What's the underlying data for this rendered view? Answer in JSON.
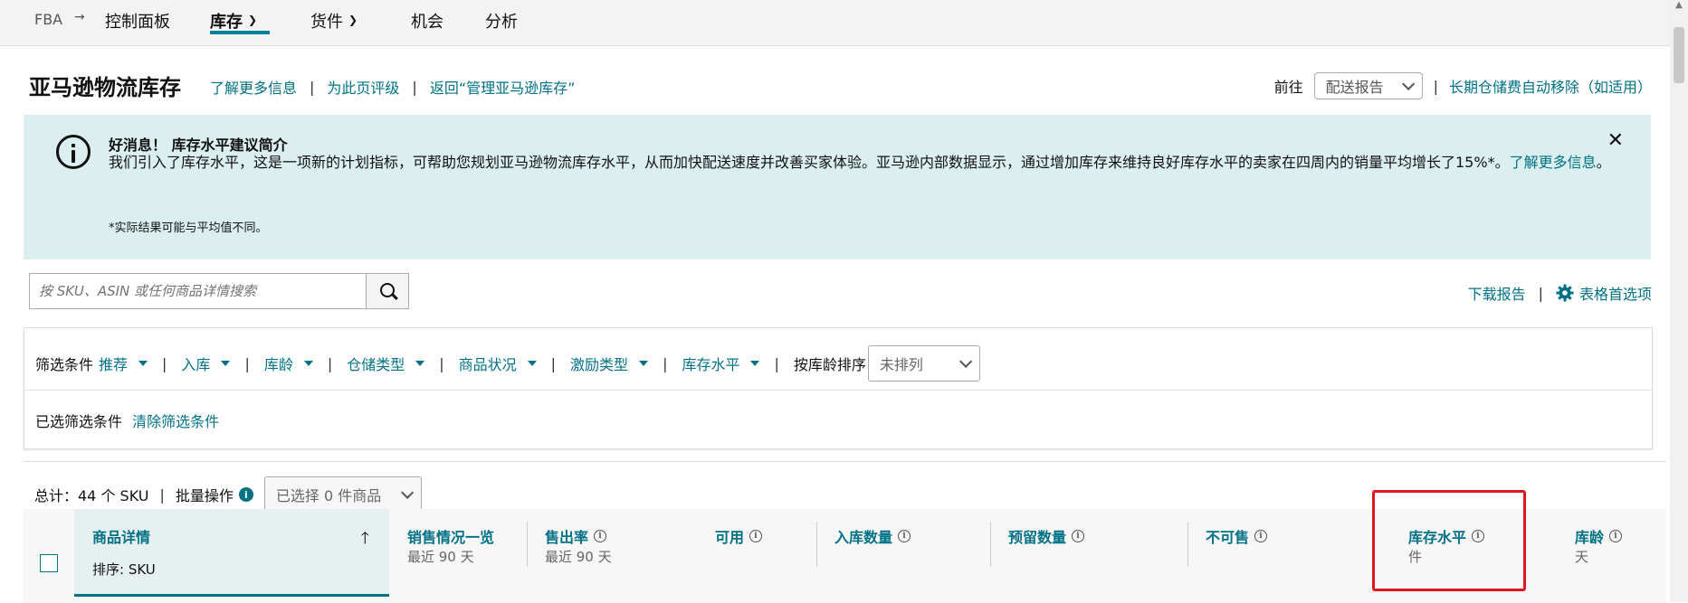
{
  "nav": {
    "root": "FBA",
    "arrow": "→",
    "items": [
      {
        "label": "控制面板",
        "chevron": false,
        "active": false
      },
      {
        "label": "库存",
        "chevron": true,
        "active": true
      },
      {
        "label": "货件",
        "chevron": true,
        "active": false
      },
      {
        "label": "机会",
        "chevron": false,
        "active": false
      },
      {
        "label": "分析",
        "chevron": false,
        "active": false
      }
    ]
  },
  "header": {
    "title": "亚马逊物流库存",
    "links": [
      "了解更多信息",
      "为此页评级",
      "返回“管理亚马逊库存”"
    ],
    "separator": "|",
    "goto_label": "前往",
    "goto_select": "配送报告",
    "right_link": "长期仓储费自动移除（如适用）"
  },
  "alert": {
    "title": "好消息！ 库存水平建议简介",
    "body": "我们引入了库存水平，这是一项新的计划指标，可帮助您规划亚马逊物流库存水平，从而加快配送速度并改善买家体验。亚马逊内部数据显示，通过增加库存来维持良好库存水平的卖家在四周内的销量平均增长了15%*。",
    "body_link": "了解更多信息",
    "body_end": "。",
    "footnote": "*实际结果可能与平均值不同。",
    "close": "✕"
  },
  "search": {
    "placeholder": "按 SKU、ASIN 或任何商品详情搜索"
  },
  "tools": {
    "download": "下载报告",
    "prefs": "表格首选项"
  },
  "filters": {
    "label": "筛选条件",
    "items": [
      "推荐",
      "入库",
      "库龄",
      "仓储类型",
      "商品状况",
      "激励类型",
      "库存水平"
    ],
    "sort_label": "按库龄排序",
    "sort_value": "未排列",
    "selected_label": "已选筛选条件",
    "clear_link": "清除筛选条件"
  },
  "toolbar": {
    "total": "总计：44 个 SKU",
    "bulk": "批量操作",
    "selected": "已选择 0 件商品"
  },
  "table": {
    "first_col": {
      "header": "商品详情",
      "sub": "排序: SKU"
    },
    "columns": [
      {
        "header": "销售情况一览",
        "sub": "最近 90 天",
        "info": false
      },
      {
        "header": "售出率",
        "sub": "最近 90 天",
        "info": true
      },
      {
        "header": "可用",
        "sub": "",
        "info": true
      },
      {
        "header": "入库数量",
        "sub": "",
        "info": true
      },
      {
        "header": "预留数量",
        "sub": "",
        "info": true
      },
      {
        "header": "不可售",
        "sub": "",
        "info": true
      },
      {
        "header": "库存水平",
        "sub": "件",
        "info": true
      },
      {
        "header": "库龄",
        "sub": "天",
        "info": true
      }
    ]
  }
}
